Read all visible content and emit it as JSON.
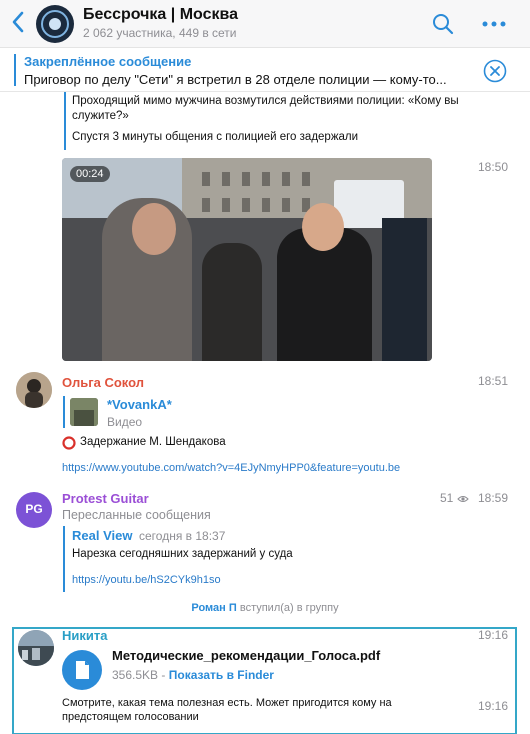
{
  "header": {
    "title": "Бессрочка | Москва",
    "subtitle": "2 062 участника, 449 в сети",
    "avatar_icon": "channel-logo-icon"
  },
  "pinned": {
    "title": "Закреплённое сообщение",
    "text": "Приговор по делу \"Сети\" я встретил в 28 отделе полиции — кому-то..."
  },
  "messages": {
    "m1": {
      "line1": "Проходящий мимо мужчина возмутился действиями полиции: «Кому вы служите?»",
      "line2": "Спустя 3 минуты общения с полицией его задержали",
      "video_duration": "00:24",
      "time": "18:50"
    },
    "m2": {
      "sender": "Ольга Сокол",
      "time": "18:51",
      "reply_author": "*VovankA*",
      "reply_type": "Видео",
      "text": "Задержание М. Шендакова",
      "link": "https://www.youtube.com/watch?v=4EJyNmyHPP0&feature=youtu.be"
    },
    "m3": {
      "avatar_initials": "PG",
      "sender": "Protest Guitar",
      "subtitle": "Пересланные сообщения",
      "views": "51",
      "time": "18:59",
      "fwd_author": "Real View",
      "fwd_time": "сегодня в 18:37",
      "text": "Нарезка сегодняшних задержаний у суда",
      "link": "https://youtu.be/hS2CYk9h1so"
    },
    "service": {
      "name": "Роман П",
      "action": "вступил(а) в группу"
    },
    "m4": {
      "sender": "Никита",
      "time": "19:16",
      "file_name": "Методические_рекомендации_Голоса.pdf",
      "file_size": "356.5KB",
      "file_sep": "-",
      "file_action": "Показать в Finder",
      "text_line1": "Смотрите, какая тема полезная есть. Может пригодится кому на",
      "text_line2": "предстоящем голосовании",
      "text_time": "19:16"
    }
  },
  "colors": {
    "accent": "#2a8bd8",
    "olga": "#e0533d",
    "protest": "#9b4fd6",
    "service": "#2a8bd8",
    "highlight": "#34a7c8"
  }
}
